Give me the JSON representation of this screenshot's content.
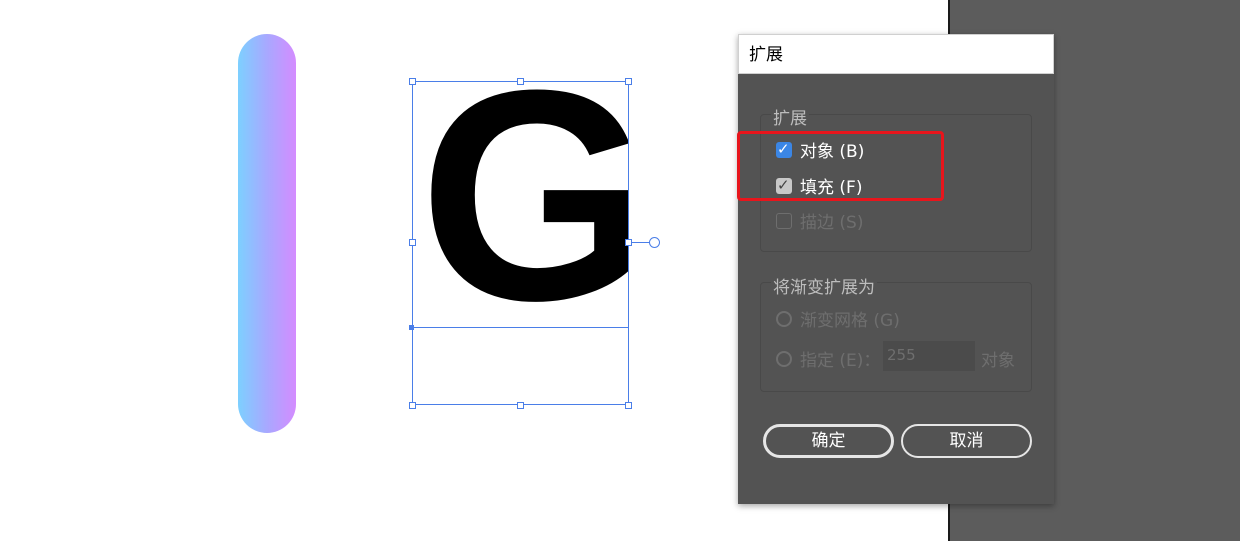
{
  "canvas": {
    "glyph": "G",
    "gradient_colors": [
      "#7dd0ff",
      "#d48cff"
    ],
    "selection_color": "#4a7ee8"
  },
  "dialog": {
    "title": "扩展",
    "expand_group": {
      "label": "扩展",
      "object": {
        "label": "对象 (B)",
        "checked": true
      },
      "fill": {
        "label": "填充 (F)",
        "checked": true
      },
      "stroke": {
        "label": "描边 (S)",
        "checked": false,
        "disabled": true
      }
    },
    "gradient_group": {
      "label": "将渐变扩展为",
      "gradient_mesh": {
        "label": "渐变网格 (G)",
        "disabled": true
      },
      "specify": {
        "label": "指定 (E)：",
        "value": "255",
        "unit": "对象",
        "disabled": true
      }
    },
    "ok_label": "确定",
    "cancel_label": "取消"
  },
  "colors": {
    "dialog_bg": "#535353",
    "checkbox_blue": "#3b86e5",
    "highlight": "#e8151c"
  }
}
